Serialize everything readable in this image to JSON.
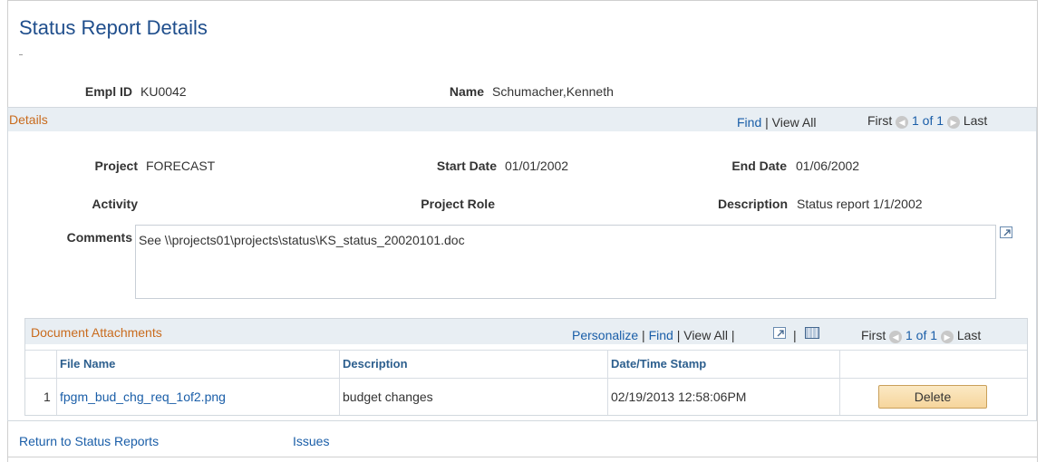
{
  "page": {
    "title": "Status Report Details"
  },
  "employee": {
    "emplid_label": "Empl ID",
    "emplid_value": "KU0042",
    "name_label": "Name",
    "name_value": "Schumacher,Kenneth"
  },
  "details": {
    "header": "Details",
    "nav": {
      "find": "Find",
      "view_all": "View All",
      "first": "First",
      "count": "1 of 1",
      "last": "Last"
    },
    "project_label": "Project",
    "project_value": "FORECAST",
    "start_label": "Start Date",
    "start_value": "01/01/2002",
    "end_label": "End Date",
    "end_value": "01/06/2002",
    "activity_label": "Activity",
    "role_label": "Project Role",
    "desc_label": "Description",
    "desc_value": "Status report 1/1/2002",
    "comments_label": "Comments",
    "comments_value": "See \\\\projects01\\projects\\status\\KS_status_20020101.doc"
  },
  "attachments": {
    "header": "Document Attachments",
    "nav": {
      "personalize": "Personalize",
      "find": "Find",
      "view_all": "View All",
      "first": "First",
      "count": "1 of 1",
      "last": "Last"
    },
    "columns": [
      "File Name",
      "Description",
      "Date/Time Stamp"
    ],
    "rows": [
      {
        "num": "1",
        "file": "fpgm_bud_chg_req_1of2.png",
        "description": "budget changes",
        "stamp": "02/19/2013 12:58:06PM",
        "action": "Delete"
      }
    ]
  },
  "footer": {
    "return_link": "Return to Status Reports",
    "issues_link": "Issues"
  },
  "icons": {
    "prev": "arrow-left-circle-icon",
    "next": "arrow-right-circle-icon",
    "expand": "expand-window-icon",
    "download": "grid-download-icon"
  }
}
